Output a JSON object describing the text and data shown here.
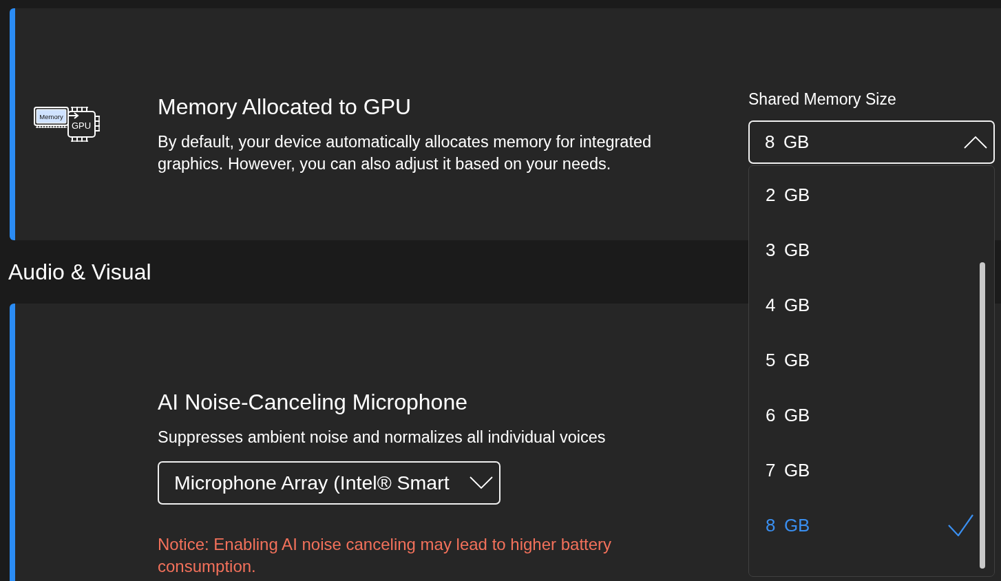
{
  "memory_card": {
    "icon": {
      "memory_text": "Memory",
      "chip_text": "GPU"
    },
    "title": "Memory Allocated to GPU",
    "description": "By default, your device automatically allocates memory for integrated graphics. However, you can also adjust it based on your needs.",
    "field_label": "Shared Memory Size",
    "select": {
      "value": "8 GB",
      "expanded": true,
      "options": [
        {
          "label": "2 GB",
          "selected": false
        },
        {
          "label": "3 GB",
          "selected": false
        },
        {
          "label": "4 GB",
          "selected": false
        },
        {
          "label": "5 GB",
          "selected": false
        },
        {
          "label": "6 GB",
          "selected": false
        },
        {
          "label": "7 GB",
          "selected": false
        },
        {
          "label": "8 GB",
          "selected": true
        }
      ]
    }
  },
  "section": {
    "heading": "Audio & Visual"
  },
  "noise_card": {
    "title": "AI Noise-Canceling Microphone",
    "description": "Suppresses ambient noise and normalizes all individual voices",
    "select": {
      "value": "Microphone Array (Intel® Smart",
      "expanded": false
    },
    "notice": "Notice: Enabling AI noise canceling may lead to higher battery consumption."
  }
}
